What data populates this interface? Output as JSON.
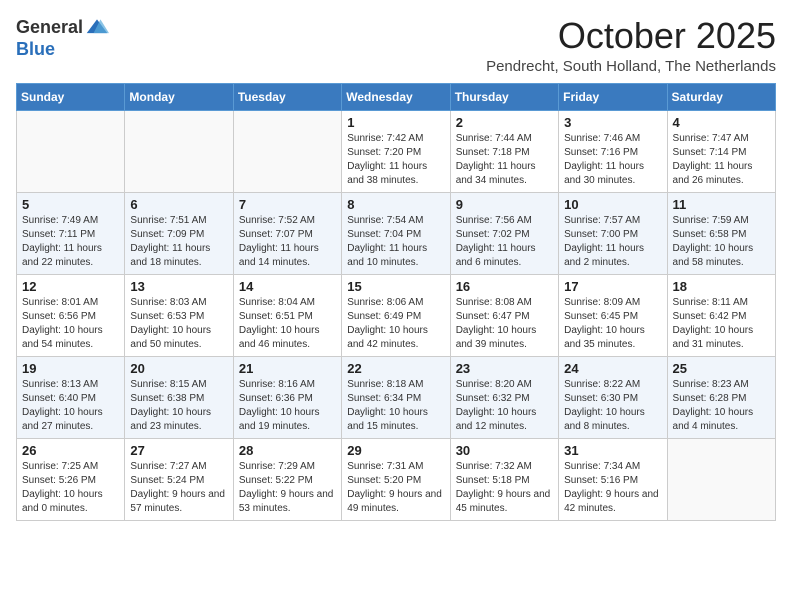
{
  "header": {
    "logo_line1": "General",
    "logo_line2": "Blue",
    "month": "October 2025",
    "location": "Pendrecht, South Holland, The Netherlands"
  },
  "weekdays": [
    "Sunday",
    "Monday",
    "Tuesday",
    "Wednesday",
    "Thursday",
    "Friday",
    "Saturday"
  ],
  "weeks": [
    [
      {
        "day": "",
        "info": ""
      },
      {
        "day": "",
        "info": ""
      },
      {
        "day": "",
        "info": ""
      },
      {
        "day": "1",
        "info": "Sunrise: 7:42 AM\nSunset: 7:20 PM\nDaylight: 11 hours and 38 minutes."
      },
      {
        "day": "2",
        "info": "Sunrise: 7:44 AM\nSunset: 7:18 PM\nDaylight: 11 hours and 34 minutes."
      },
      {
        "day": "3",
        "info": "Sunrise: 7:46 AM\nSunset: 7:16 PM\nDaylight: 11 hours and 30 minutes."
      },
      {
        "day": "4",
        "info": "Sunrise: 7:47 AM\nSunset: 7:14 PM\nDaylight: 11 hours and 26 minutes."
      }
    ],
    [
      {
        "day": "5",
        "info": "Sunrise: 7:49 AM\nSunset: 7:11 PM\nDaylight: 11 hours and 22 minutes."
      },
      {
        "day": "6",
        "info": "Sunrise: 7:51 AM\nSunset: 7:09 PM\nDaylight: 11 hours and 18 minutes."
      },
      {
        "day": "7",
        "info": "Sunrise: 7:52 AM\nSunset: 7:07 PM\nDaylight: 11 hours and 14 minutes."
      },
      {
        "day": "8",
        "info": "Sunrise: 7:54 AM\nSunset: 7:04 PM\nDaylight: 11 hours and 10 minutes."
      },
      {
        "day": "9",
        "info": "Sunrise: 7:56 AM\nSunset: 7:02 PM\nDaylight: 11 hours and 6 minutes."
      },
      {
        "day": "10",
        "info": "Sunrise: 7:57 AM\nSunset: 7:00 PM\nDaylight: 11 hours and 2 minutes."
      },
      {
        "day": "11",
        "info": "Sunrise: 7:59 AM\nSunset: 6:58 PM\nDaylight: 10 hours and 58 minutes."
      }
    ],
    [
      {
        "day": "12",
        "info": "Sunrise: 8:01 AM\nSunset: 6:56 PM\nDaylight: 10 hours and 54 minutes."
      },
      {
        "day": "13",
        "info": "Sunrise: 8:03 AM\nSunset: 6:53 PM\nDaylight: 10 hours and 50 minutes."
      },
      {
        "day": "14",
        "info": "Sunrise: 8:04 AM\nSunset: 6:51 PM\nDaylight: 10 hours and 46 minutes."
      },
      {
        "day": "15",
        "info": "Sunrise: 8:06 AM\nSunset: 6:49 PM\nDaylight: 10 hours and 42 minutes."
      },
      {
        "day": "16",
        "info": "Sunrise: 8:08 AM\nSunset: 6:47 PM\nDaylight: 10 hours and 39 minutes."
      },
      {
        "day": "17",
        "info": "Sunrise: 8:09 AM\nSunset: 6:45 PM\nDaylight: 10 hours and 35 minutes."
      },
      {
        "day": "18",
        "info": "Sunrise: 8:11 AM\nSunset: 6:42 PM\nDaylight: 10 hours and 31 minutes."
      }
    ],
    [
      {
        "day": "19",
        "info": "Sunrise: 8:13 AM\nSunset: 6:40 PM\nDaylight: 10 hours and 27 minutes."
      },
      {
        "day": "20",
        "info": "Sunrise: 8:15 AM\nSunset: 6:38 PM\nDaylight: 10 hours and 23 minutes."
      },
      {
        "day": "21",
        "info": "Sunrise: 8:16 AM\nSunset: 6:36 PM\nDaylight: 10 hours and 19 minutes."
      },
      {
        "day": "22",
        "info": "Sunrise: 8:18 AM\nSunset: 6:34 PM\nDaylight: 10 hours and 15 minutes."
      },
      {
        "day": "23",
        "info": "Sunrise: 8:20 AM\nSunset: 6:32 PM\nDaylight: 10 hours and 12 minutes."
      },
      {
        "day": "24",
        "info": "Sunrise: 8:22 AM\nSunset: 6:30 PM\nDaylight: 10 hours and 8 minutes."
      },
      {
        "day": "25",
        "info": "Sunrise: 8:23 AM\nSunset: 6:28 PM\nDaylight: 10 hours and 4 minutes."
      }
    ],
    [
      {
        "day": "26",
        "info": "Sunrise: 7:25 AM\nSunset: 5:26 PM\nDaylight: 10 hours and 0 minutes."
      },
      {
        "day": "27",
        "info": "Sunrise: 7:27 AM\nSunset: 5:24 PM\nDaylight: 9 hours and 57 minutes."
      },
      {
        "day": "28",
        "info": "Sunrise: 7:29 AM\nSunset: 5:22 PM\nDaylight: 9 hours and 53 minutes."
      },
      {
        "day": "29",
        "info": "Sunrise: 7:31 AM\nSunset: 5:20 PM\nDaylight: 9 hours and 49 minutes."
      },
      {
        "day": "30",
        "info": "Sunrise: 7:32 AM\nSunset: 5:18 PM\nDaylight: 9 hours and 45 minutes."
      },
      {
        "day": "31",
        "info": "Sunrise: 7:34 AM\nSunset: 5:16 PM\nDaylight: 9 hours and 42 minutes."
      },
      {
        "day": "",
        "info": ""
      }
    ]
  ]
}
